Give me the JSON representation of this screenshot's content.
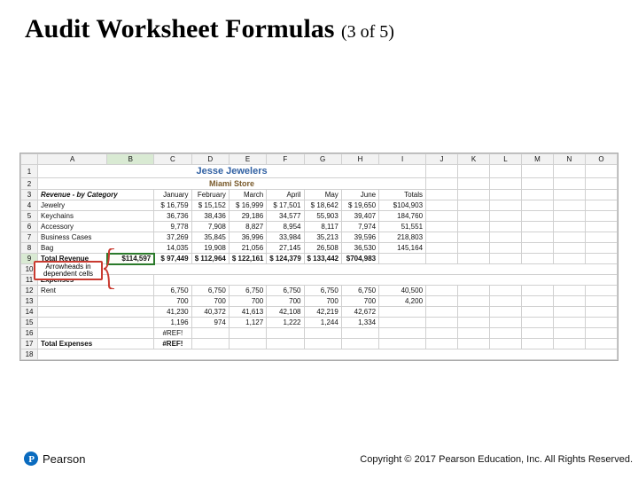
{
  "slide": {
    "title_main": "Audit Worksheet Formulas",
    "title_counter": "(3 of 5)"
  },
  "sheet": {
    "cols": [
      "A",
      "B",
      "C",
      "D",
      "E",
      "F",
      "G",
      "H",
      "I",
      "J",
      "K",
      "L",
      "M",
      "N",
      "O"
    ],
    "brand_title": "Jesse Jewelers",
    "brand_sub": "Miami Store",
    "revenue_header": "Revenue - by Category",
    "months": [
      "January",
      "February",
      "March",
      "April",
      "May",
      "June",
      "Totals"
    ],
    "rows_revenue": [
      {
        "label": "Jewelry",
        "vals": [
          "$  16,759",
          "$    15,152",
          "$  16,999",
          "$  17,501",
          "$  18,642",
          "$  19,650",
          "$104,903"
        ]
      },
      {
        "label": "Keychains",
        "vals": [
          "36,736",
          "38,436",
          "29,186",
          "34,577",
          "55,903",
          "39,407",
          "184,760"
        ]
      },
      {
        "label": "Accessory",
        "vals": [
          "9,778",
          "7,908",
          "8,827",
          "8,954",
          "8,117",
          "7,974",
          "51,551"
        ]
      },
      {
        "label": "Business Cases",
        "vals": [
          "37,269",
          "35,845",
          "36,996",
          "33,984",
          "35,213",
          "39,596",
          "218,803"
        ]
      },
      {
        "label": "Bag",
        "vals": [
          "14,035",
          "19,908",
          "21,056",
          "27,145",
          "26,508",
          "36,530",
          "145,164"
        ]
      }
    ],
    "total_revenue": {
      "label": "Total Revenue",
      "vals": [
        "$114,597",
        "$    97,449",
        "$ 112,964",
        "$ 122,161",
        "$ 124,379",
        "$ 133,442",
        "$704,983"
      ]
    },
    "expenses_header": "Expenses",
    "rows_expenses": [
      {
        "label": "Rent",
        "vals": [
          "6,750",
          "6,750",
          "6,750",
          "6,750",
          "6,750",
          "6,750",
          "40,500"
        ]
      },
      {
        "label": "",
        "vals": [
          "700",
          "700",
          "700",
          "700",
          "700",
          "700",
          "4,200"
        ]
      },
      {
        "label": "",
        "vals": [
          "41,230",
          "40,372",
          "41,613",
          "42,108",
          "42,219",
          "42,672",
          ""
        ]
      },
      {
        "label": "",
        "vals": [
          "1,196",
          "974",
          "1,127",
          "1,222",
          "1,244",
          "1,334",
          ""
        ]
      },
      {
        "label": "",
        "vals": [
          "#REF!",
          "",
          "",
          "",
          "",
          "",
          ""
        ]
      }
    ],
    "total_expenses": {
      "label": "Total Expenses",
      "vals": [
        "#REF!",
        "",
        "",
        "",
        "",
        "",
        ""
      ]
    },
    "callout": "Arrowheads in dependent cells"
  },
  "footer": {
    "brand": "Pearson",
    "copyright": "Copyright © 2017 Pearson Education, Inc. All Rights Reserved."
  }
}
